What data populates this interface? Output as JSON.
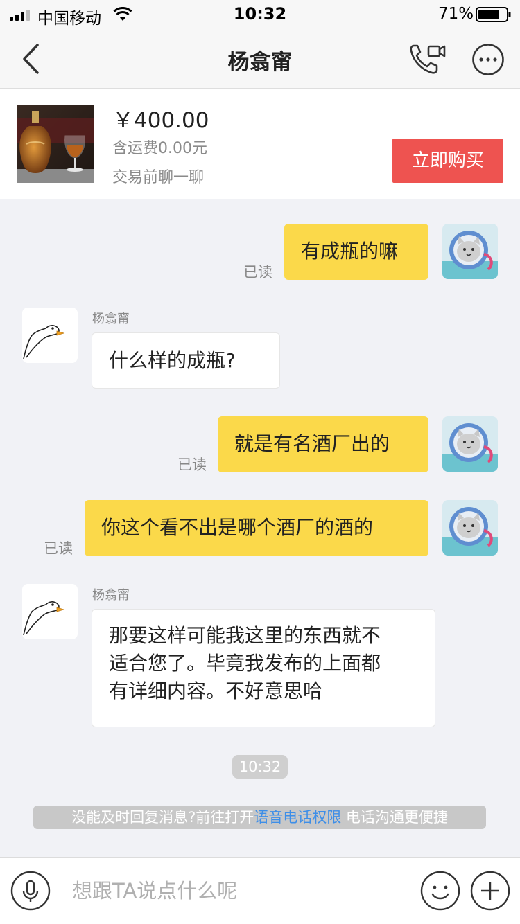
{
  "status_bar": {
    "carrier": "中国移动",
    "time": "10:32",
    "battery": "71%",
    "battery_level": 0.71
  },
  "nav": {
    "title": "杨翕甯",
    "back_icon": "chevron-left-icon",
    "call_icon": "voice-video-call-icon",
    "more_icon": "more-dots-icon"
  },
  "product": {
    "price": "￥400.00",
    "shipping": "含运费0.00元",
    "chat_hint": "交易前聊一聊",
    "buy_label": "立即购买",
    "buy_color": "#ee5350"
  },
  "messages": [
    {
      "from": "me",
      "text": "有成瓶的嘛",
      "status": "已读"
    },
    {
      "from": "them",
      "sender": "杨翕甯",
      "text": "什么样的成瓶?"
    },
    {
      "from": "me",
      "text": "就是有名酒厂出的",
      "status": "已读"
    },
    {
      "from": "me",
      "text": "你这个看不出是哪个酒厂的酒的",
      "status": "已读"
    },
    {
      "from": "them",
      "sender": "杨翕甯",
      "lines": [
        "那要这样可能我这里的东西就不",
        "适合您了。毕竟我发布的上面都",
        "有详细内容。不好意思哈"
      ]
    }
  ],
  "timestamp": "10:32",
  "notice": {
    "before": "没能及时回复消息?前往打开",
    "link": "语音电话权限",
    "after": " 电话沟通更便捷"
  },
  "input": {
    "placeholder": "想跟TA说点什么呢",
    "mic_icon": "microphone-icon",
    "emoji_icon": "smiley-icon",
    "plus_icon": "plus-icon"
  },
  "colors": {
    "my_bubble": "#fbd94a",
    "their_bubble": "#ffffff",
    "background": "#f1f2f6",
    "link": "#3d8ee8"
  }
}
